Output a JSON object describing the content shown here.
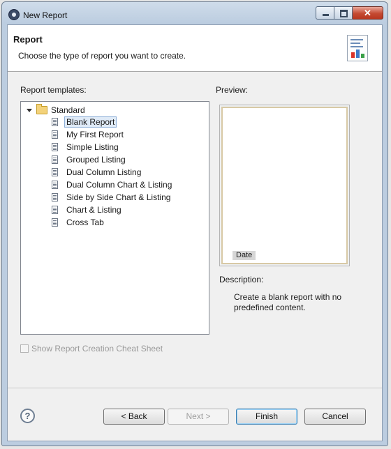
{
  "window": {
    "title": "New Report"
  },
  "header": {
    "title": "Report",
    "description": "Choose the type of report you want to create."
  },
  "templates": {
    "label": "Report templates:",
    "root": "Standard",
    "items": [
      {
        "label": "Blank Report",
        "selected": true
      },
      {
        "label": "My First Report"
      },
      {
        "label": "Simple Listing"
      },
      {
        "label": "Grouped Listing"
      },
      {
        "label": "Dual Column Listing"
      },
      {
        "label": "Dual Column Chart & Listing"
      },
      {
        "label": "Side by Side Chart & Listing"
      },
      {
        "label": "Chart & Listing"
      },
      {
        "label": "Cross Tab"
      }
    ]
  },
  "preview": {
    "label": "Preview:",
    "date_tag": "Date"
  },
  "description": {
    "label": "Description:",
    "text": "Create a blank report with no predefined content."
  },
  "cheat_sheet": {
    "label": "Show Report Creation Cheat Sheet",
    "checked": false
  },
  "buttons": {
    "help": "?",
    "back": "< Back",
    "next": "Next >",
    "finish": "Finish",
    "cancel": "Cancel"
  }
}
